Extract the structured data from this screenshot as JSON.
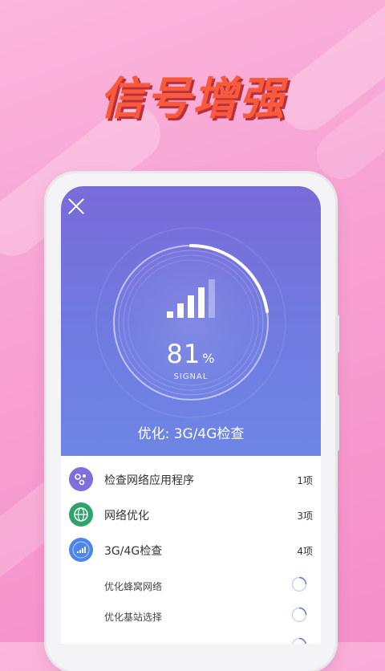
{
  "headline": "信号增强",
  "signal": {
    "value": "81",
    "unit": "%",
    "label": "SIGNAL",
    "progress": 0.81
  },
  "status_text": "优化: 3G/4G检查",
  "items": [
    {
      "label": "检查网络应用程序",
      "count": "1项",
      "icon": "network-apps-icon",
      "color": "#7d6fdc"
    },
    {
      "label": "网络优化",
      "count": "3项",
      "icon": "globe-icon",
      "color": "#2fa36b"
    },
    {
      "label": "3G/4G检查",
      "count": "4项",
      "icon": "signal-icon",
      "color": "#4e86e8"
    }
  ],
  "subitems": [
    {
      "label": "优化蜂窝网络"
    },
    {
      "label": "优化基站选择"
    }
  ]
}
